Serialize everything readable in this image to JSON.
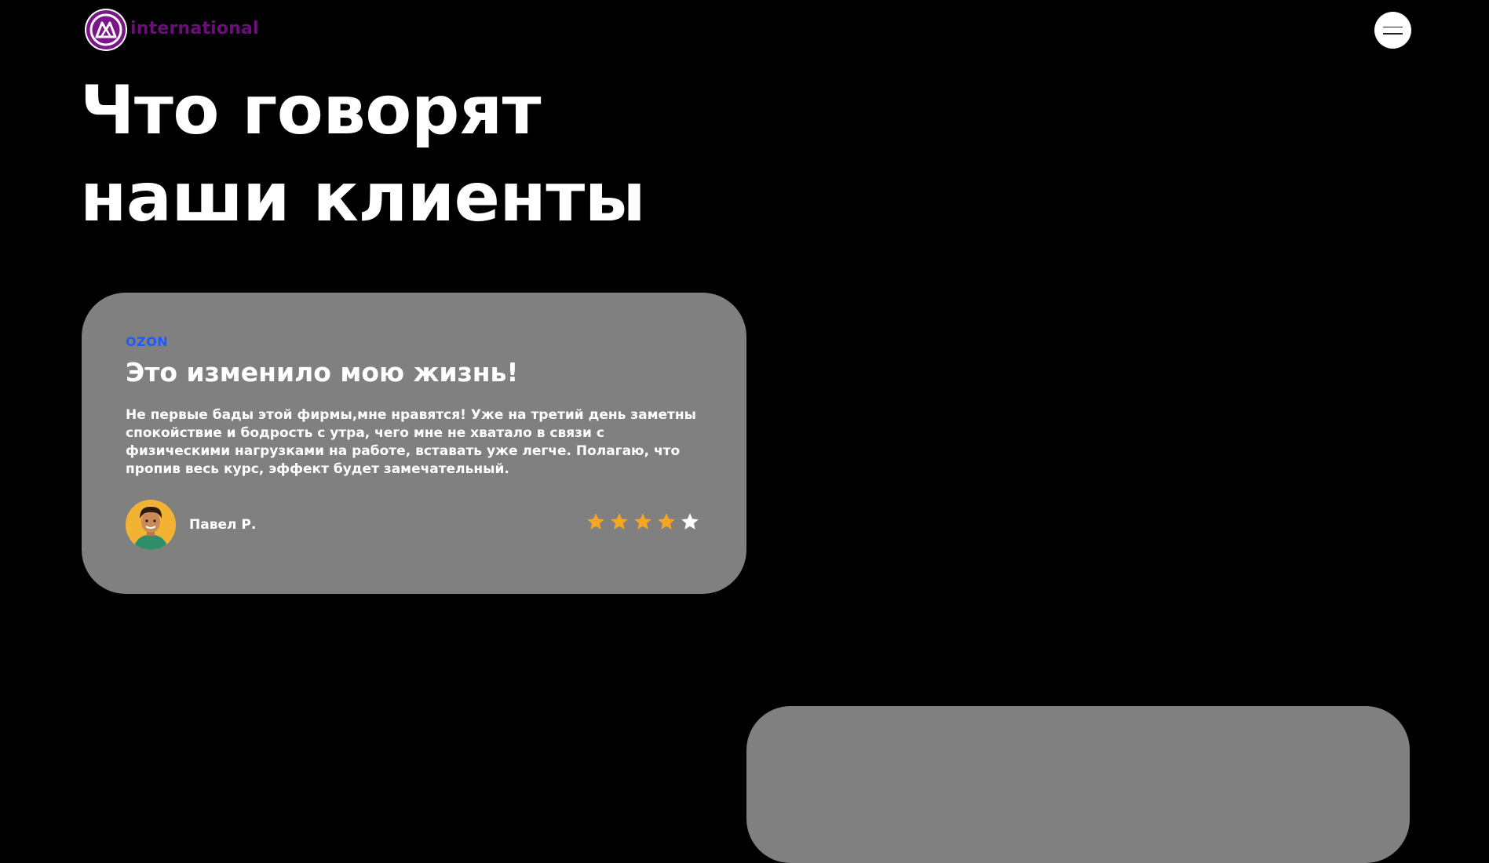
{
  "header": {
    "logo_text": "international",
    "logo_icon": "international-logo-icon",
    "menu_icon": "hamburger-menu-icon"
  },
  "page": {
    "title_line1": "Что говорят",
    "title_line2": "наши клиенты"
  },
  "reviews": [
    {
      "source": "OZON",
      "title": "Это изменило мою жизнь!",
      "text": "Не первые бады этой фирмы,мне нравятся! Уже на третий день заметны спокойствие и бодрость с утра, чего мне не хватало в связи с физическими нагрузками на работе, вставать уже легче. Полагаю, что пропив весь курс, эффект будет замечательный.",
      "author": "Павел Р.",
      "rating": 4,
      "rating_max": 5
    }
  ],
  "colors": {
    "background": "#000000",
    "card": "#808080",
    "brand_purple": "#6a0f77",
    "ozon_blue": "#1a5cff",
    "star_filled": "#f5a623",
    "star_empty": "#ffffff"
  }
}
